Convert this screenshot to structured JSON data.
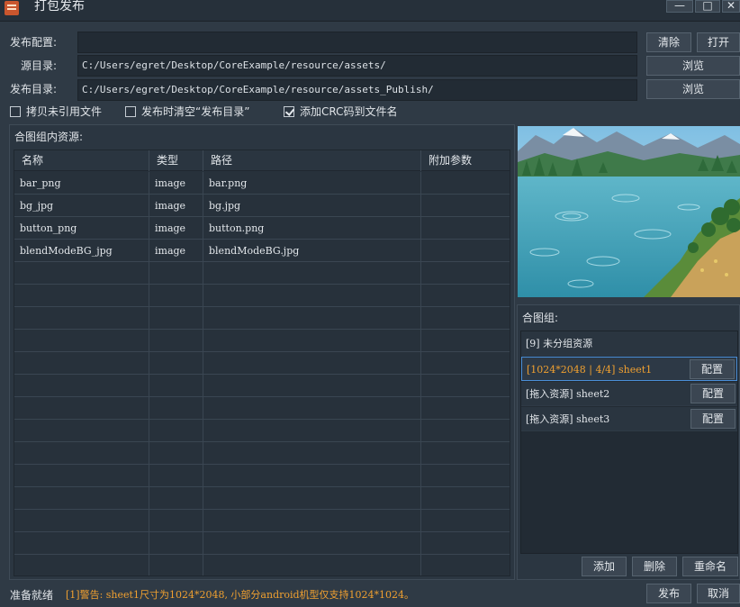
{
  "window": {
    "title": "打包发布",
    "minimize_label": "—",
    "maximize_label": "□",
    "close_label": "✕"
  },
  "config": {
    "publish_config_label": "发布配置:",
    "publish_config_value": "",
    "clear_label": "清除",
    "open_label": "打开",
    "source_dir_label": "源目录:",
    "source_dir_value": "C:/Users/egret/Desktop/CoreExample/resource/assets/",
    "browse_label": "浏览",
    "publish_dir_label": "发布目录:",
    "publish_dir_value": "C:/Users/egret/Desktop/CoreExample/resource/assets_Publish/"
  },
  "options": [
    {
      "label": "拷贝未引用文件",
      "checked": false
    },
    {
      "label": "发布时清空“发布目录”",
      "checked": false
    },
    {
      "label": "添加CRC码到文件名",
      "checked": true
    }
  ],
  "resources": {
    "title": "合图组内资源:",
    "columns": [
      "名称",
      "类型",
      "路径",
      "附加参数"
    ],
    "rows": [
      {
        "name": "bar_png",
        "type": "image",
        "path": "bar.png",
        "extra": ""
      },
      {
        "name": "bg_jpg",
        "type": "image",
        "path": "bg.jpg",
        "extra": ""
      },
      {
        "name": "button_png",
        "type": "image",
        "path": "button.png",
        "extra": ""
      },
      {
        "name": "blendModeBG_jpg",
        "type": "image",
        "path": "blendModeBG.jpg",
        "extra": ""
      }
    ]
  },
  "groups": {
    "title": "合图组:",
    "items": [
      {
        "label": "[9] 未分组资源",
        "has_button": false,
        "selected": false
      },
      {
        "label": "[1024*2048 | 4/4] sheet1",
        "has_button": true,
        "selected": true
      },
      {
        "label": "[拖入资源] sheet2",
        "has_button": true,
        "selected": false
      },
      {
        "label": "[拖入资源] sheet3",
        "has_button": true,
        "selected": false
      }
    ],
    "config_label": "配置",
    "add_label": "添加",
    "delete_label": "删除",
    "rename_label": "重命名"
  },
  "status": {
    "ready": "准备就绪",
    "warning": "[1]警告: sheet1尺寸为1024*2048, 小部分android机型仅支持1024*1024。",
    "warning_color": "#f0a030"
  },
  "footer": {
    "publish_label": "发布",
    "cancel_label": "取消"
  },
  "colors": {
    "background": "#2f3a45",
    "selected_group_text": "#f0a030",
    "selected_border": "#4a8fd8"
  }
}
